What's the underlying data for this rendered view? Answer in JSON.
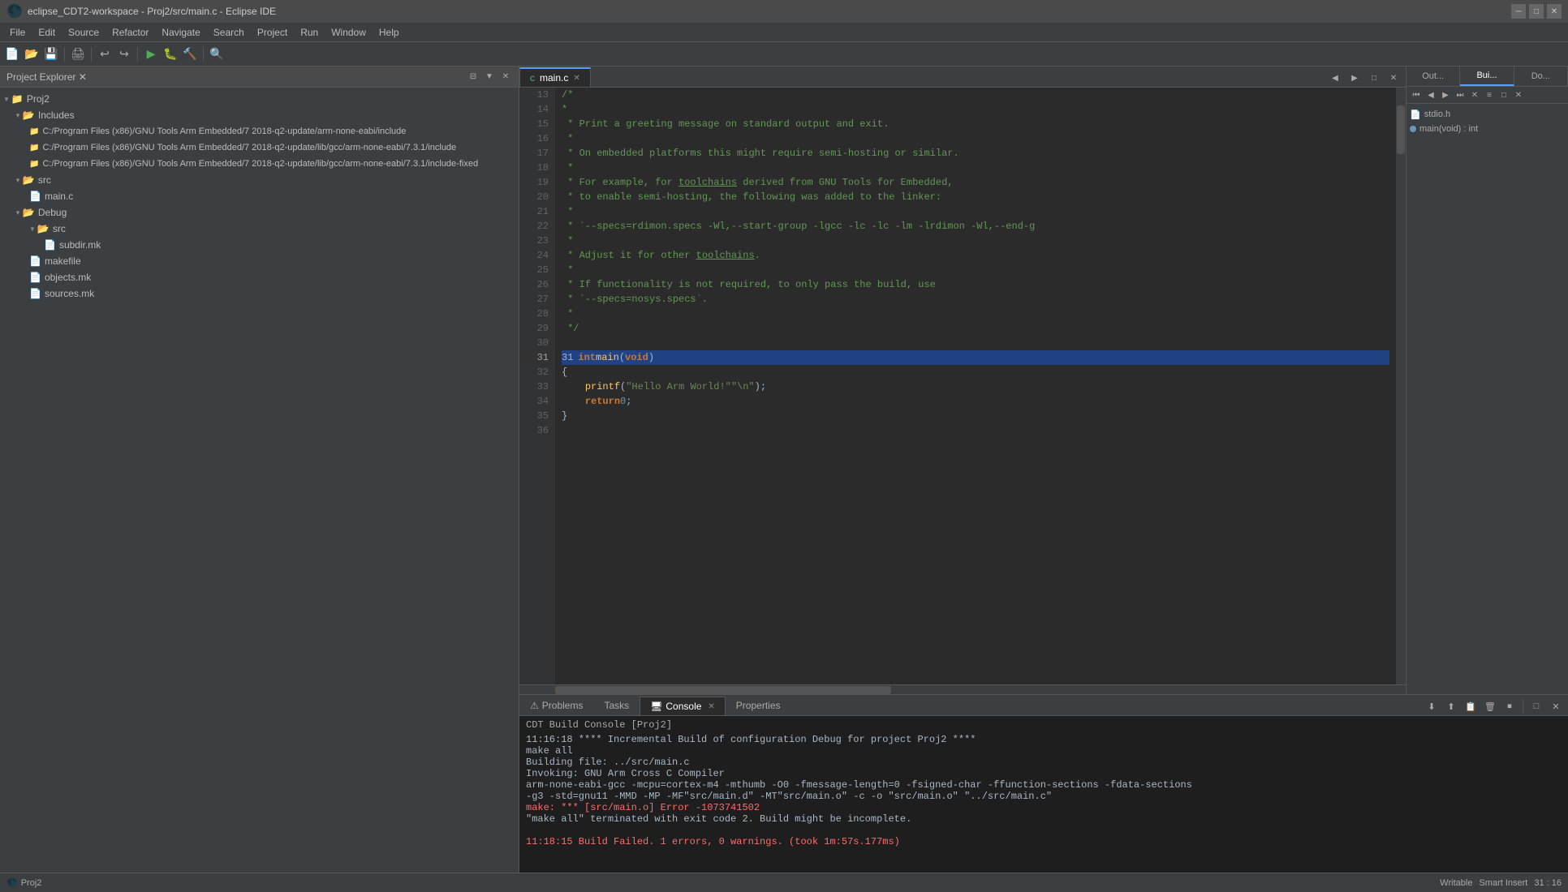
{
  "titlebar": {
    "title": "eclipse_CDT2-workspace - Proj2/src/main.c - Eclipse IDE",
    "minimize": "─",
    "maximize": "□",
    "close": "✕"
  },
  "menubar": {
    "items": [
      "File",
      "Edit",
      "Source",
      "Refactor",
      "Navigate",
      "Search",
      "Project",
      "Run",
      "Window",
      "Help"
    ]
  },
  "projectExplorer": {
    "header": "Project Explorer",
    "tree": [
      {
        "id": "proj2",
        "label": "Proj2",
        "level": 0,
        "type": "project",
        "expanded": true
      },
      {
        "id": "includes",
        "label": "Includes",
        "level": 1,
        "type": "folder",
        "expanded": true
      },
      {
        "id": "inc1",
        "label": "C:/Program Files (x86)/GNU Tools Arm Embedded/7 2018-q2-update/arm-none-eabi/include",
        "level": 2,
        "type": "include"
      },
      {
        "id": "inc2",
        "label": "C:/Program Files (x86)/GNU Tools Arm Embedded/7 2018-q2-update/lib/gcc/arm-none-eabi/7.3.1/include",
        "level": 2,
        "type": "include"
      },
      {
        "id": "inc3",
        "label": "C:/Program Files (x86)/GNU Tools Arm Embedded/7 2018-q2-update/lib/gcc/arm-none-eabi/7.3.1/include-fixed",
        "level": 2,
        "type": "include"
      },
      {
        "id": "src",
        "label": "src",
        "level": 1,
        "type": "folder",
        "expanded": true
      },
      {
        "id": "mainc",
        "label": "main.c",
        "level": 2,
        "type": "cfile"
      },
      {
        "id": "debug",
        "label": "Debug",
        "level": 1,
        "type": "folder",
        "expanded": true
      },
      {
        "id": "debugsrc",
        "label": "src",
        "level": 2,
        "type": "folder",
        "expanded": true
      },
      {
        "id": "subdirmk",
        "label": "subdir.mk",
        "level": 3,
        "type": "file"
      },
      {
        "id": "makefile",
        "label": "makefile",
        "level": 2,
        "type": "file"
      },
      {
        "id": "objectsmk",
        "label": "objects.mk",
        "level": 2,
        "type": "file"
      },
      {
        "id": "sourcesmk",
        "label": "sources.mk",
        "level": 2,
        "type": "file"
      }
    ]
  },
  "editor": {
    "tab": "main.c",
    "lines": [
      {
        "num": 13,
        "content": "/*",
        "type": "comment"
      },
      {
        "num": 14,
        "content": " *",
        "type": "comment"
      },
      {
        "num": 15,
        "content": " * Print a greeting message on standard output and exit.",
        "type": "comment"
      },
      {
        "num": 16,
        "content": " *",
        "type": "comment"
      },
      {
        "num": 17,
        "content": " * On embedded platforms this might require semi-hosting or similar.",
        "type": "comment"
      },
      {
        "num": 18,
        "content": " *",
        "type": "comment"
      },
      {
        "num": 19,
        "content": " * For example, for toolchains derived from GNU Tools for Embedded,",
        "type": "comment"
      },
      {
        "num": 20,
        "content": " * to enable semi-hosting, the following was added to the linker:",
        "type": "comment"
      },
      {
        "num": 21,
        "content": " *",
        "type": "comment"
      },
      {
        "num": 22,
        "content": " * `--specs=rdimon.specs -Wl,--start-group -lgcc -lc -lc -lm -lrdimon -Wl,--end-g",
        "type": "comment"
      },
      {
        "num": 23,
        "content": " *",
        "type": "comment"
      },
      {
        "num": 24,
        "content": " * Adjust it for other toolchains.",
        "type": "comment"
      },
      {
        "num": 25,
        "content": " *",
        "type": "comment"
      },
      {
        "num": 26,
        "content": " * If functionality is not required, to only pass the build, use",
        "type": "comment"
      },
      {
        "num": 27,
        "content": " * `--specs=nosys.specs`.",
        "type": "comment"
      },
      {
        "num": 28,
        "content": " *",
        "type": "comment"
      },
      {
        "num": 29,
        "content": " */",
        "type": "comment"
      },
      {
        "num": 30,
        "content": "",
        "type": "normal"
      },
      {
        "num": 31,
        "content": "int main(void)",
        "type": "function_def",
        "highlighted": true
      },
      {
        "num": 32,
        "content": "{",
        "type": "normal"
      },
      {
        "num": 33,
        "content": "    printf(\"Hello Arm World!\" \"\\n\");",
        "type": "normal"
      },
      {
        "num": 34,
        "content": "    return 0;",
        "type": "normal"
      },
      {
        "num": 35,
        "content": "}",
        "type": "normal"
      },
      {
        "num": 36,
        "content": "",
        "type": "normal"
      }
    ]
  },
  "rightPanel": {
    "tabs": [
      "Out...",
      "Bui...",
      "Do..."
    ],
    "items": [
      {
        "label": "stdio.h"
      },
      {
        "label": "main(void) : int"
      }
    ]
  },
  "bottomPanel": {
    "tabs": [
      "Problems",
      "Tasks",
      "Console",
      "Properties"
    ],
    "activeTab": "Console",
    "consoleTitle": "CDT Build Console [Proj2]",
    "lines": [
      {
        "type": "normal",
        "text": "11:16:18 **** Incremental Build of configuration Debug for project Proj2 ****"
      },
      {
        "type": "normal",
        "text": "make all"
      },
      {
        "type": "normal",
        "text": "Building file: ../src/main.c"
      },
      {
        "type": "normal",
        "text": "Invoking: GNU Arm Cross C Compiler"
      },
      {
        "type": "normal",
        "text": "arm-none-eabi-gcc -mcpu=cortex-m4 -mthumb -O0 -fmessage-length=0 -fsigned-char -ffunction-sections -fdata-sections"
      },
      {
        "type": "normal",
        "text": "-g3 -std=gnu11 -MMD -MP -MF\"src/main.d\" -MT\"src/main.o\" -c -o \"src/main.o\" \"../src/main.c\""
      },
      {
        "type": "error",
        "text": "make: *** [src/main.o] Error -1073741502"
      },
      {
        "type": "normal",
        "text": "\"make all\" terminated with exit code 2. Build might be incomplete."
      },
      {
        "type": "normal",
        "text": ""
      },
      {
        "type": "error",
        "text": "11:18:15 Build Failed. 1 errors, 0 warnings. (took 1m:57s.177ms)"
      }
    ]
  },
  "statusBar": {
    "left": "Proj2",
    "right": ""
  }
}
